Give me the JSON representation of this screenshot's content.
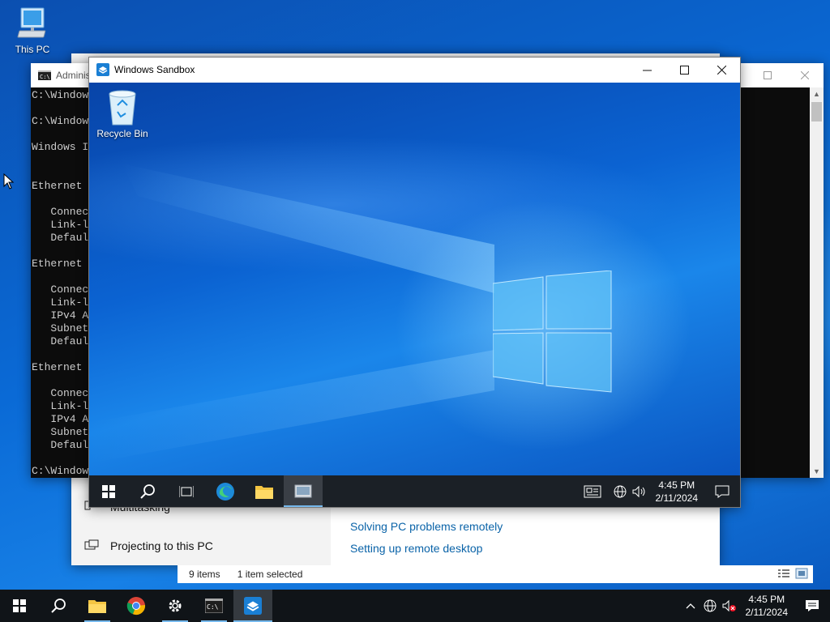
{
  "desktop": {
    "icons": [
      {
        "label": "This PC",
        "icon": "computer-icon"
      }
    ],
    "wallpaper_color": "#0a62c9"
  },
  "settings_window": {
    "nav_items": [
      {
        "label": "Multitasking",
        "icon": "multitasking-icon"
      },
      {
        "label": "Projecting to this PC",
        "icon": "projecting-icon"
      }
    ],
    "links": [
      "Solving PC problems remotely",
      "Setting up remote desktop"
    ],
    "link_color": "#0a63a8"
  },
  "explorer": {
    "status": {
      "items": "9 items",
      "selected": "1 item selected"
    }
  },
  "cmd_window": {
    "title": "Administrator",
    "lines": [
      "C:\\Windows",
      "",
      "C:\\Windows",
      "",
      "Windows I",
      "",
      "",
      "Ethernet",
      "",
      "   Connec",
      "   Link-l",
      "   Defaul",
      "",
      "Ethernet",
      "",
      "   Connec",
      "   Link-l",
      "   IPv4 A",
      "   Subnet",
      "   Defaul",
      "",
      "Ethernet",
      "",
      "   Connec",
      "   Link-l",
      "   IPv4 A",
      "   Subnet",
      "   Defaul",
      "",
      "C:\\Window"
    ]
  },
  "sandbox_window": {
    "title": "Windows Sandbox",
    "desktop_icons": [
      {
        "label": "Recycle Bin",
        "icon": "recycle-bin-icon"
      }
    ],
    "taskbar": {
      "buttons": [
        {
          "name": "start-button",
          "icon": "windows-logo-icon"
        },
        {
          "name": "search-button",
          "icon": "search-icon"
        },
        {
          "name": "task-view-button",
          "icon": "task-view-icon"
        },
        {
          "name": "edge-button",
          "icon": "edge-icon"
        },
        {
          "name": "file-explorer-button",
          "icon": "folder-icon"
        },
        {
          "name": "sandbox-app-button",
          "icon": "app-icon",
          "active": true
        }
      ],
      "clock": {
        "time": "4:45 PM",
        "date": "2/11/2024"
      }
    }
  },
  "taskbar": {
    "buttons": [
      {
        "name": "start-button",
        "icon": "windows-logo-icon"
      },
      {
        "name": "search-button",
        "icon": "search-icon"
      },
      {
        "name": "file-explorer-button",
        "icon": "folder-icon",
        "running": true
      },
      {
        "name": "chrome-button",
        "icon": "chrome-icon"
      },
      {
        "name": "settings-button",
        "icon": "gear-icon",
        "running": true
      },
      {
        "name": "terminal-button",
        "icon": "cmd-icon",
        "running": true
      },
      {
        "name": "windows-sandbox-button",
        "icon": "sandbox-icon",
        "active": true
      }
    ],
    "clock": {
      "time": "4:45 PM",
      "date": "2/11/2024"
    }
  },
  "colors": {
    "accent": "#76b9ed",
    "taskbar": "#101418"
  }
}
